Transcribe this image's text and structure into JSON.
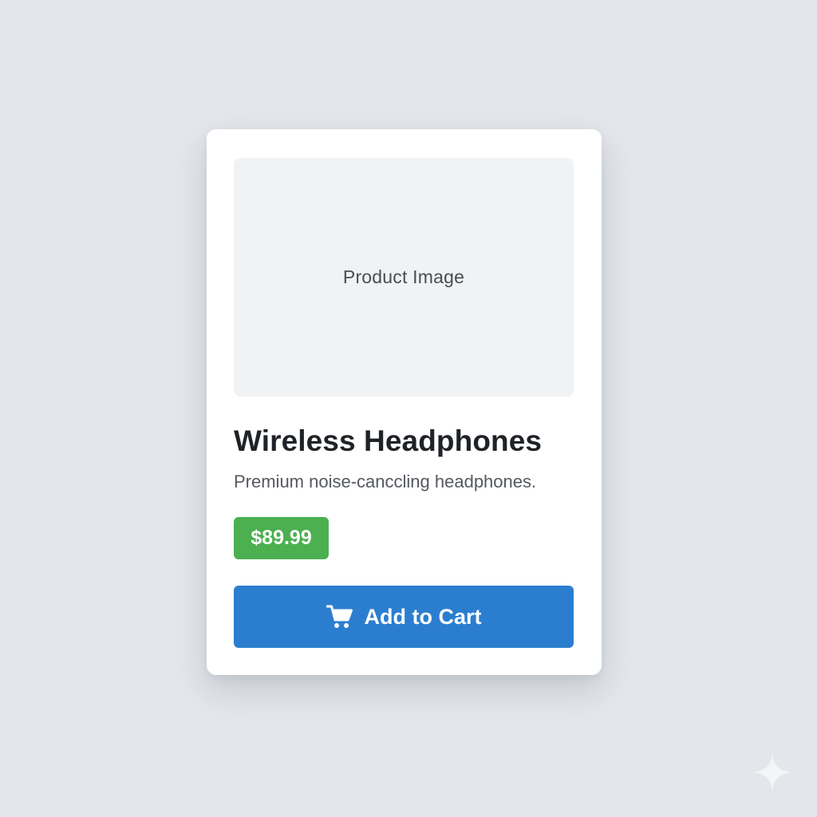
{
  "product": {
    "image_label": "Product Image",
    "title": "Wireless Headphones",
    "description": "Premium noise-canccling headphones.",
    "price": "$89.99"
  },
  "cart_button": {
    "label": "Add to Cart",
    "icon": "shopping-cart-icon"
  },
  "colors": {
    "background": "#e3e6ea",
    "card": "#ffffff",
    "price_badge": "#4caf50",
    "button": "#2b7ecf"
  }
}
